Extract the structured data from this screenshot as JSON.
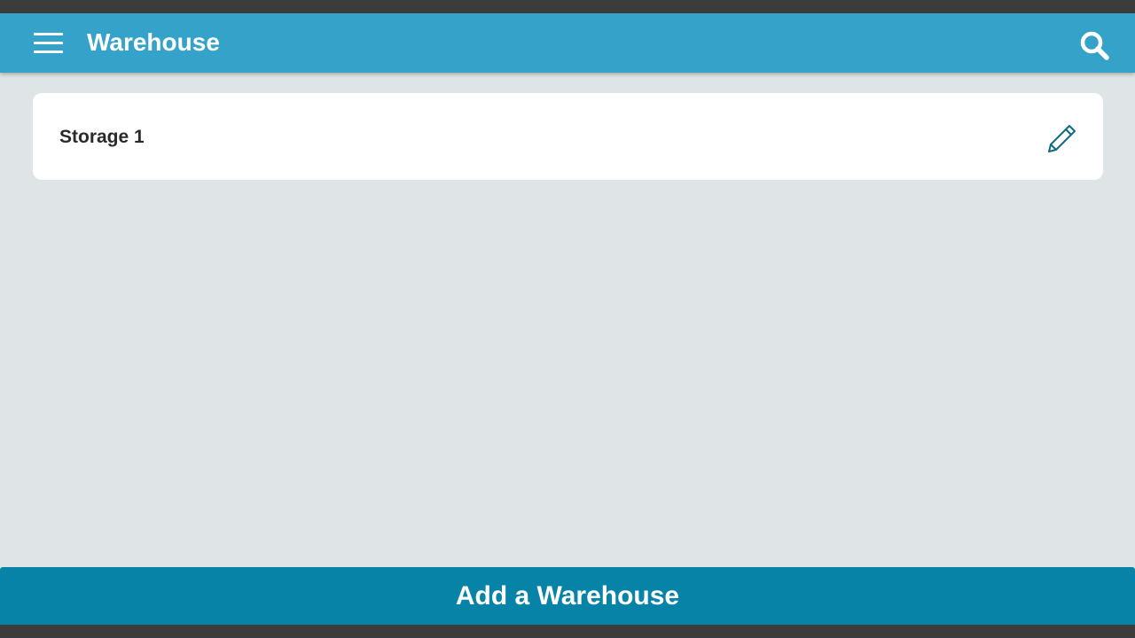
{
  "appbar": {
    "title": "Warehouse",
    "menu_icon": "hamburger-menu-icon",
    "search_icon": "search-icon"
  },
  "warehouses": [
    {
      "name": "Storage 1",
      "action_icon": "pencil-edit-icon"
    }
  ],
  "footer": {
    "add_label": "Add a Warehouse"
  },
  "colors": {
    "appbar": "#35a3c9",
    "button": "#0883a8",
    "background": "#dfe4e7",
    "icon": "#0f6a7e"
  }
}
